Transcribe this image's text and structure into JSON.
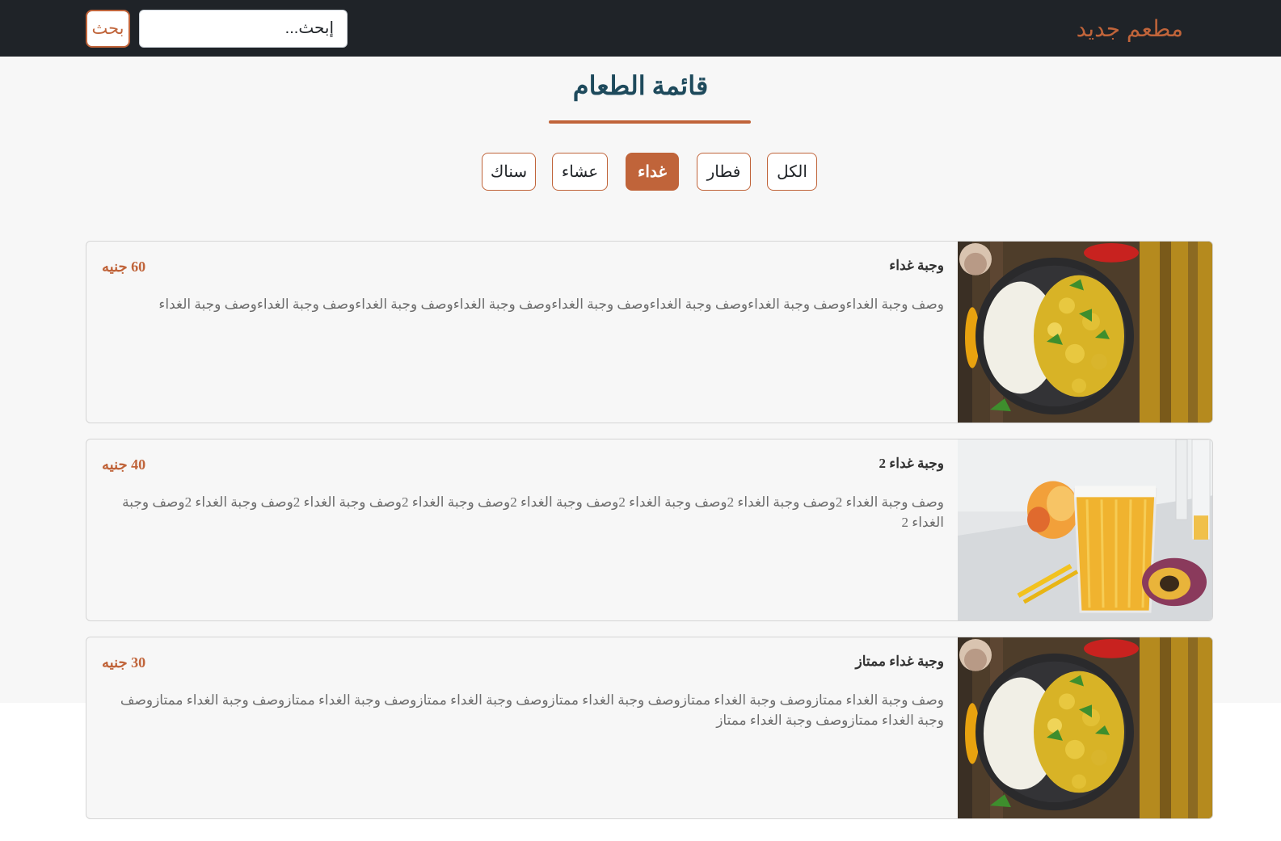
{
  "navbar": {
    "brand": "مطعم جديد",
    "search_placeholder": "إبحث...",
    "search_button": "بحث"
  },
  "menu": {
    "title": "قائمة الطعام",
    "filters": [
      "الكل",
      "فطار",
      "غداء",
      "عشاء",
      "سناك"
    ],
    "active_filter": "غداء",
    "items": [
      {
        "title": "وجبة غداء",
        "price": "60 جنيه",
        "description": "وصف وجبة الغداءوصف وجبة الغداءوصف وجبة الغداءوصف وجبة الغداءوصف وجبة الغداءوصف وجبة الغداءوصف وجبة الغداءوصف وجبة الغداء",
        "image": "chickpea-curry-rice-bowl"
      },
      {
        "title": "وجبة غداء 2",
        "price": "40 جنيه",
        "description": "وصف وجبة الغداء 2وصف وجبة الغداء 2وصف وجبة الغداء 2وصف وجبة الغداء 2وصف وجبة الغداء 2وصف وجبة الغداء 2وصف وجبة الغداء 2وصف وجبة الغداء 2",
        "image": "mango-juice-glass"
      },
      {
        "title": "وجبة غداء ممتاز",
        "price": "30 جنيه",
        "description": "وصف وجبة الغداء ممتازوصف وجبة الغداء ممتازوصف وجبة الغداء ممتازوصف وجبة الغداء ممتازوصف وجبة الغداء ممتازوصف وجبة الغداء ممتازوصف وجبة الغداء ممتازوصف وجبة الغداء ممتاز",
        "image": "chickpea-curry-rice-bowl"
      }
    ]
  },
  "colors": {
    "accent": "#c0643a",
    "navbar": "#1f2328",
    "title": "#1e4a5c"
  }
}
